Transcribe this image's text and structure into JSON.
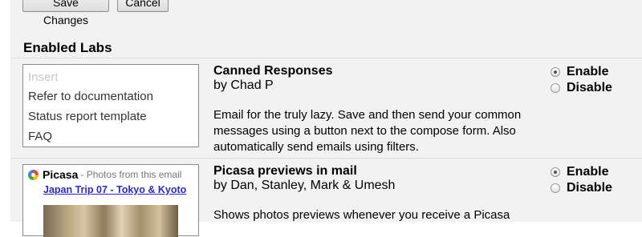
{
  "toolbar": {
    "save_label": "Save Changes",
    "cancel_label": "Cancel"
  },
  "section": {
    "title": "Enabled Labs"
  },
  "labs": [
    {
      "title": "Canned Responses",
      "author": "by Chad P",
      "description": "Email for the truly lazy. Save and then send your common messages using a button next to the compose form. Also automatically send emails using filters.",
      "preview_items": [
        "Insert",
        "Refer to documentation",
        "Status report template",
        "FAQ"
      ],
      "enable_label": "Enable",
      "disable_label": "Disable",
      "selected": "Enable"
    },
    {
      "title": "Picasa previews in mail",
      "author": "by Dan, Stanley, Mark & Umesh",
      "description": "Shows photos previews whenever you receive a Picasa",
      "preview": {
        "app_name": "Picasa",
        "app_sub": "- Photos from this email",
        "album_link": "Japan Trip 07 - Tokyo & Kyoto"
      },
      "enable_label": "Enable",
      "disable_label": "Disable",
      "selected": "Enable"
    }
  ],
  "icons": {
    "radio": "radio-button",
    "picasa": "picasa-logo-icon"
  }
}
